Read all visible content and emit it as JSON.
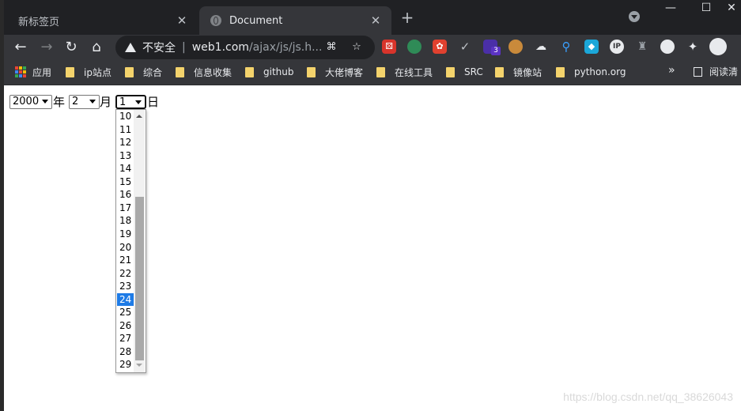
{
  "tabs": [
    {
      "title": "新标签页",
      "active": false
    },
    {
      "title": "Document",
      "active": true
    }
  ],
  "tab_close_glyph": "✕",
  "new_tab_glyph": "+",
  "window_controls": {
    "minimize": "—",
    "maximize": "☐",
    "close": "✕"
  },
  "toolbar": {
    "insecure_label": "不安全",
    "url_host": "web1.com",
    "url_path": "/ajax/js/js.h...",
    "extensions_badge": "3"
  },
  "bookmarks": {
    "apps_label": "应用",
    "items": [
      "ip站点",
      "综合",
      "信息收集",
      "github",
      "大佬博客",
      "在线工具",
      "SRC",
      "镜像站",
      "python.org"
    ],
    "more": "»",
    "reading_list": "阅读清"
  },
  "form": {
    "year_value": "2000",
    "year_unit": "年",
    "month_value": "2",
    "month_unit": "月",
    "day_value": "1",
    "day_unit": "日"
  },
  "day_dropdown": {
    "options": [
      "10",
      "11",
      "12",
      "13",
      "14",
      "15",
      "16",
      "17",
      "18",
      "19",
      "20",
      "21",
      "22",
      "23",
      "24",
      "25",
      "26",
      "27",
      "28",
      "29"
    ],
    "highlighted": "24"
  },
  "watermark": "https://blog.csdn.net/qq_38626043",
  "colors": {
    "highlight": "#1e7be6",
    "folder": "#f4d36c",
    "chrome_dark": "#202124",
    "toolbar": "#35363a"
  }
}
